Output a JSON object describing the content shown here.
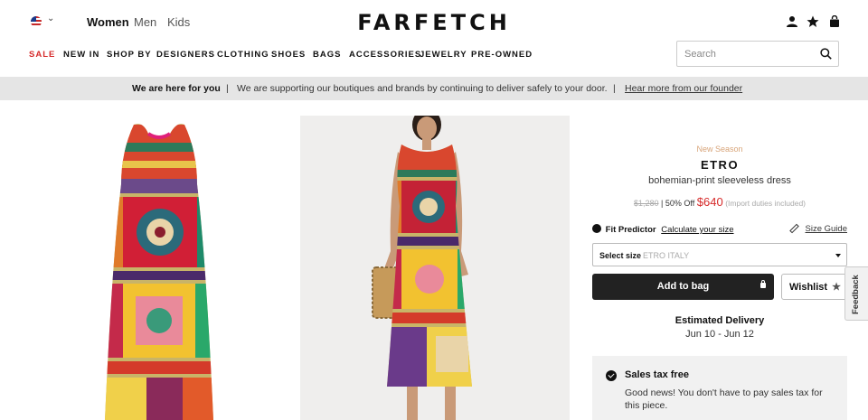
{
  "header": {
    "logo": "FARFETCH",
    "gender_tabs": [
      {
        "label": "Women",
        "active": true
      },
      {
        "label": "Men",
        "active": false
      },
      {
        "label": "Kids",
        "active": false
      }
    ],
    "region_flag": "us-flag-icon",
    "icons": [
      "account-icon",
      "wishlist-star-icon",
      "shopping-bag-icon"
    ]
  },
  "nav": {
    "items": [
      "SALE",
      "NEW IN",
      "SHOP BY",
      "DESIGNERS",
      "CLOTHING",
      "SHOES",
      "BAGS",
      "ACCESSORIES",
      "JEWELRY",
      "PRE-OWNED"
    ],
    "search_placeholder": "Search",
    "sale_color": "#d62b2b"
  },
  "banner": {
    "title": "We are here for you",
    "separator": "|",
    "message": "We are supporting our boutiques and brands by continuing to deliver safely to your door.",
    "link": "Hear more from our founder"
  },
  "product": {
    "season": "New Season",
    "brand": "ETRO",
    "name": "bohemian-print sleeveless dress",
    "original_price": "$1,280",
    "discount": "| 50% Off",
    "price": "$640",
    "duties": "(Import duties included)",
    "fit_predictor_title": "Fit Predictor",
    "fit_predictor_link": "Calculate your size",
    "size_guide": "Size Guide",
    "select_size_label": "Select size",
    "select_size_value": "ETRO ITALY",
    "add_to_bag": "Add to bag",
    "wishlist": "Wishlist",
    "delivery_title": "Estimated Delivery",
    "delivery_dates": "Jun 10 - Jun 12",
    "tax_title": "Sales tax free",
    "tax_body": "Good news! You don't have to pay sales tax for this piece."
  },
  "feedback_tab": "Feedback"
}
